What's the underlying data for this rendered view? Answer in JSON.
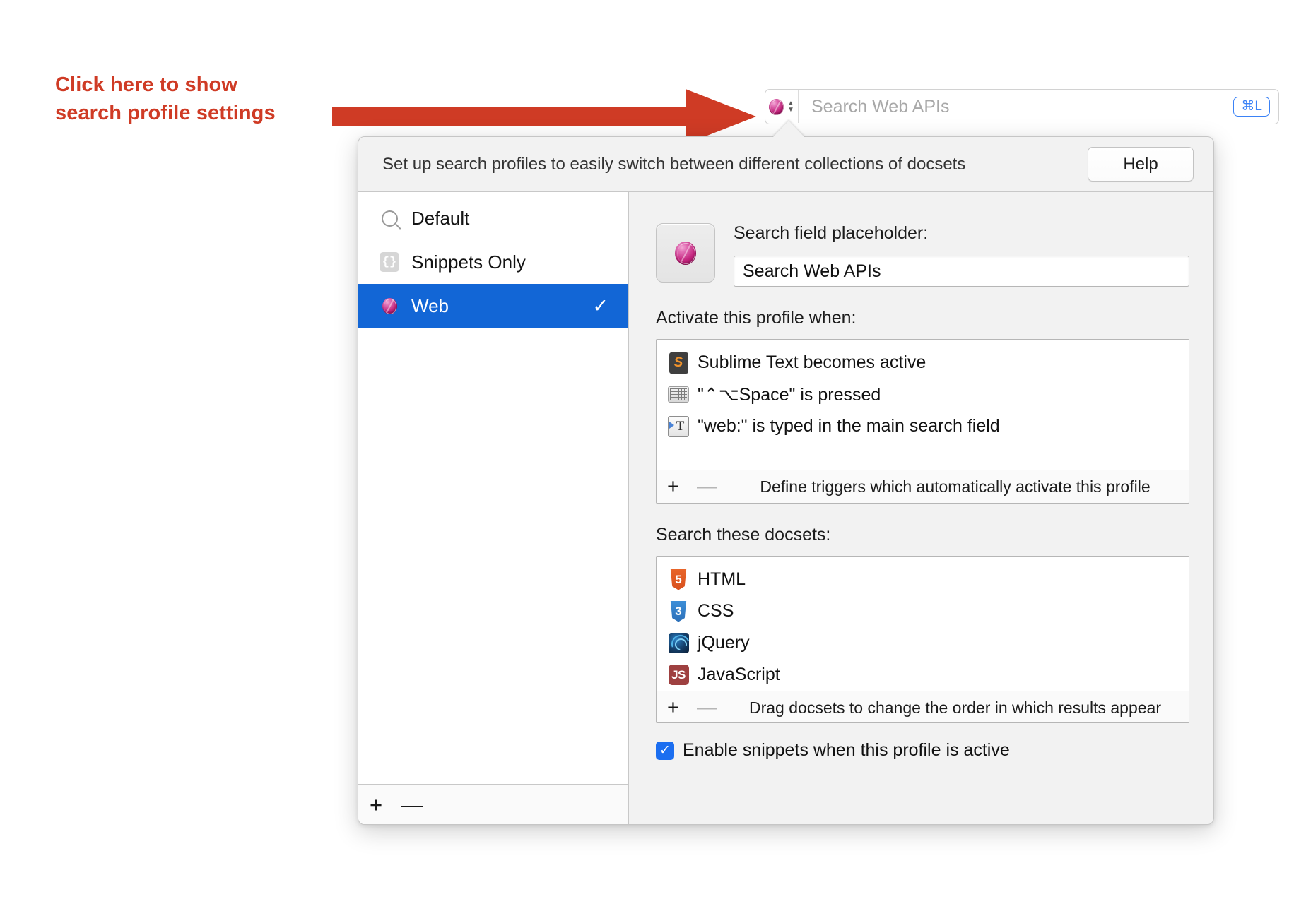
{
  "annotation": {
    "line1": "Click here to show",
    "line2": "search profile settings",
    "color": "#cf3b25",
    "arrow_icon": "right-arrow-annotation"
  },
  "searchbar": {
    "profile_icon": "web-profile-orb-icon",
    "stepper_icon": "stepper-up-down-icon",
    "placeholder": "Search Web APIs",
    "shortcut_badge": "⌘L"
  },
  "popover": {
    "header": {
      "description": "Set up search profiles to easily switch between different collections of docsets",
      "help_label": "Help"
    },
    "sidebar": {
      "profiles": [
        {
          "label": "Default",
          "icon": "magnifier-icon",
          "selected": false,
          "checked": false
        },
        {
          "label": "Snippets Only",
          "icon": "snippets-braces-icon",
          "selected": false,
          "checked": false
        },
        {
          "label": "Web",
          "icon": "web-profile-orb-icon",
          "selected": true,
          "checked": true,
          "check_glyph": "✓"
        }
      ],
      "footer": {
        "add_label": "+",
        "remove_label": "—"
      }
    },
    "detail": {
      "profile_icon": "web-profile-orb-icon",
      "placeholder_label": "Search field placeholder:",
      "placeholder_value": "Search Web APIs",
      "triggers": {
        "section_label": "Activate this profile when:",
        "items": [
          {
            "text": "Sublime Text becomes active",
            "icon": "sublime-text-icon"
          },
          {
            "text": "\"⌃⌥Space\" is pressed",
            "icon": "keyboard-icon"
          },
          {
            "text": "\"web:\" is typed in the main search field",
            "icon": "typed-text-icon"
          }
        ],
        "footer": {
          "add_label": "+",
          "remove_label": "—",
          "hint": "Define triggers which automatically activate this profile"
        }
      },
      "docsets": {
        "section_label": "Search these docsets:",
        "items": [
          {
            "text": "HTML",
            "icon": "html5-shield-icon",
            "badge": "5"
          },
          {
            "text": "CSS",
            "icon": "css3-shield-icon",
            "badge": "3"
          },
          {
            "text": "jQuery",
            "icon": "jquery-icon",
            "badge": ""
          },
          {
            "text": "JavaScript",
            "icon": "javascript-icon",
            "badge": "JS"
          }
        ],
        "footer": {
          "add_label": "+",
          "remove_label": "—",
          "hint": "Drag docsets to change the order in which results appear"
        }
      },
      "enable_snippets": {
        "label": "Enable snippets when this profile is active",
        "checked": true,
        "check_glyph": "✓"
      }
    }
  },
  "colors": {
    "accent_blue": "#1266d6",
    "annotation_red": "#cf3b25",
    "badge_blue": "#3b82f6",
    "checkbox_blue": "#1b6ef0"
  }
}
